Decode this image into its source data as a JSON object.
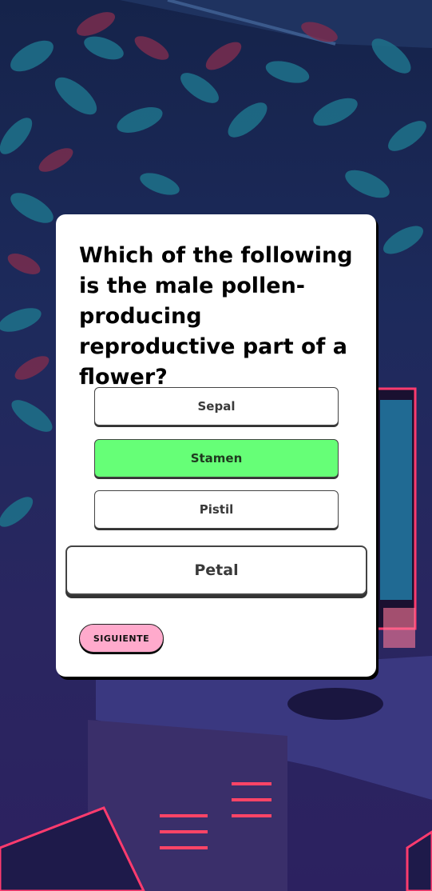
{
  "quiz": {
    "question": "Which of the following is the male pollen-producing reproductive part of a flower?",
    "answers": [
      {
        "label": "Sepal",
        "state": "default"
      },
      {
        "label": "Stamen",
        "state": "correct"
      },
      {
        "label": "Pistil",
        "state": "default"
      },
      {
        "label": "Petal",
        "state": "default"
      }
    ],
    "next_label": "SIGUIENTE"
  },
  "colors": {
    "correct": "#66ff77",
    "next_button": "#ffaacc",
    "card": "#ffffff"
  }
}
